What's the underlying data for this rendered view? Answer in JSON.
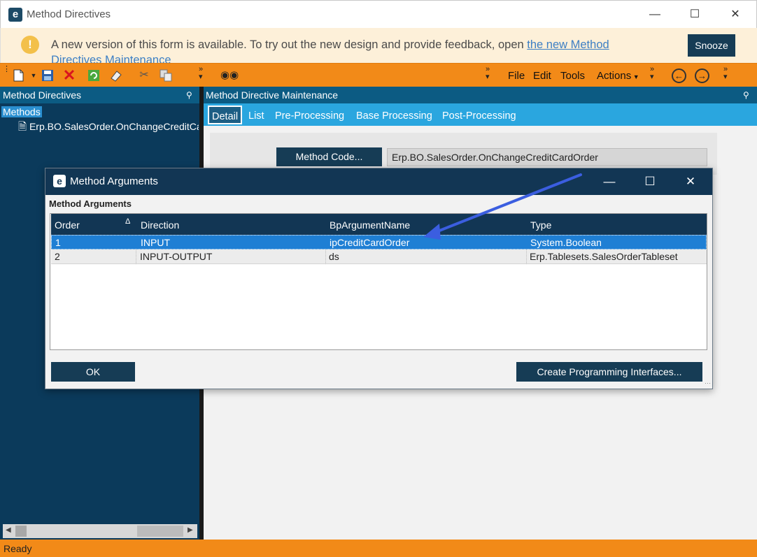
{
  "window": {
    "title": "Method Directives",
    "logo": "e"
  },
  "banner": {
    "text": "A new version of this form is available. To try out the new design and provide feedback, open ",
    "link_text": "the new Method Directives Maintenance",
    "snooze_label": "Snooze",
    "icon": "!"
  },
  "toolbar": {
    "menus": [
      "File",
      "Edit",
      "Tools",
      "Actions"
    ],
    "icons": [
      "new-icon",
      "save-icon",
      "delete-icon",
      "refresh-icon",
      "clear-icon",
      "cut-icon",
      "copy-icon",
      "search-icon",
      "back-icon",
      "forward-icon"
    ]
  },
  "left": {
    "header": "Method Directives",
    "root": "Methods",
    "child": "Erp.BO.SalesOrder.OnChangeCreditCardOrder"
  },
  "right": {
    "header": "Method Directive Maintenance",
    "tabs": [
      "Detail",
      "List",
      "Pre-Processing",
      "Base Processing",
      "Post-Processing"
    ],
    "method_code_label": "Method Code...",
    "method_code_value": "Erp.BO.SalesOrder.OnChangeCreditCardOrder"
  },
  "dialog": {
    "title": "Method Arguments",
    "section_label": "Method Arguments",
    "columns": [
      "Order",
      "Direction",
      "BpArgumentName",
      "Type"
    ],
    "rows": [
      {
        "order": "1",
        "direction": "INPUT",
        "name": "ipCreditCardOrder",
        "type": "System.Boolean"
      },
      {
        "order": "2",
        "direction": "INPUT-OUTPUT",
        "name": "ds",
        "type": "Erp.Tablesets.SalesOrderTableset"
      }
    ],
    "ok_label": "OK",
    "create_label": "Create Programming Interfaces..."
  },
  "status": {
    "text": "Ready"
  },
  "colors": {
    "accent": "#f28a18",
    "navy": "#123654",
    "selection": "#1f7fd4",
    "annotation_arrow": "#3b5ee0"
  }
}
